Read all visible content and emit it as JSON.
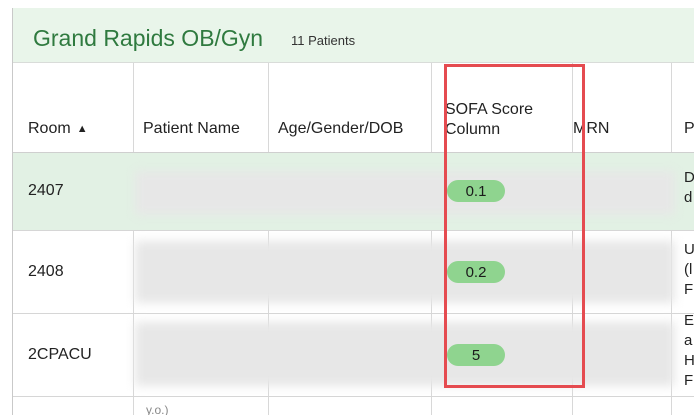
{
  "header": {
    "unit_name": "Grand Rapids OB/Gyn",
    "patient_count": "11 Patients"
  },
  "columns": {
    "room": "Room",
    "patient_name": "Patient Name",
    "age_gender_dob": "Age/Gender/DOB",
    "sofa_line1": "SOFA Score",
    "sofa_line2": "Column",
    "mrn": "MRN",
    "next": "P"
  },
  "sort_icon": "triangle-up",
  "rows": [
    {
      "room": "2407",
      "sofa": "0.1",
      "cut_text": "D\nd"
    },
    {
      "room": "2408",
      "sofa": "0.2",
      "cut_text": "U\n(l\nF"
    },
    {
      "room": "2CPACU",
      "sofa": "5",
      "cut_text": "E\na\nH\nF"
    }
  ],
  "fragment_text": "y.o.)",
  "colors": {
    "title_text": "#2f7a3f",
    "title_bg": "#e9f5ea",
    "selected_row_bg": "#e2f1e4",
    "sofa_pill": "#8fd48f",
    "highlight_border": "#e54b50"
  }
}
